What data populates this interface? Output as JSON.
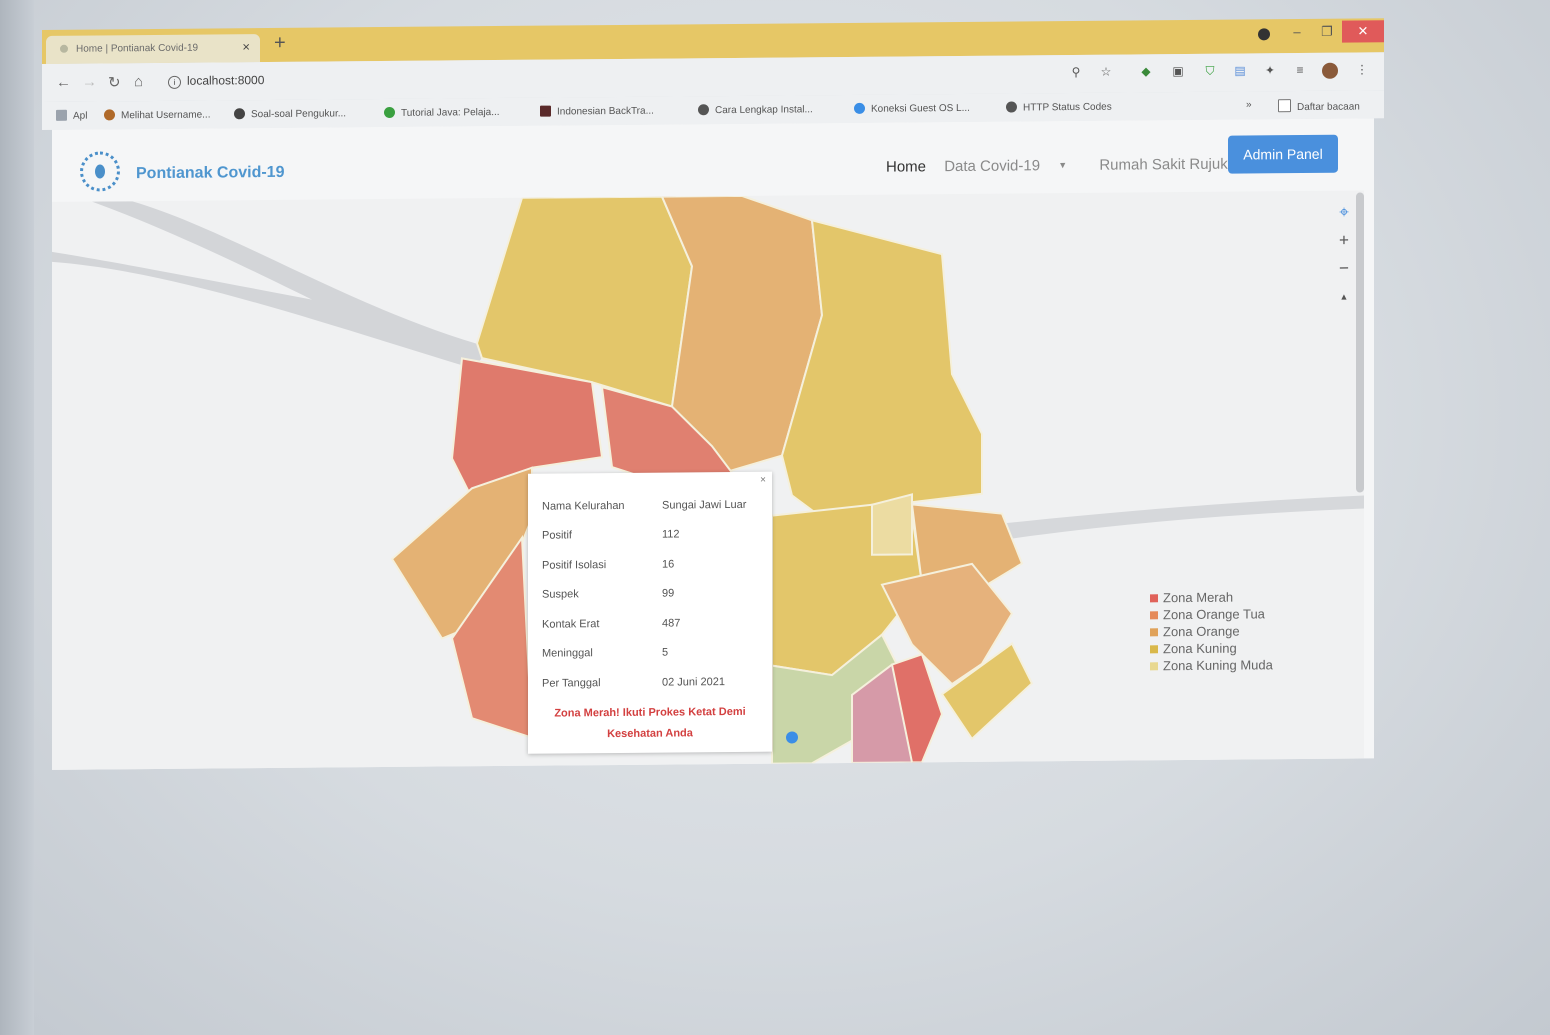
{
  "browser": {
    "tab_title": "Home | Pontianak Covid-19",
    "tab_close": "×",
    "new_tab": "+",
    "window_buttons": [
      "–",
      "❐",
      "✕"
    ],
    "address": "localhost:8000",
    "bookmarks": [
      "Apl",
      "Melihat Username...",
      "Soal-soal Pengukur...",
      "Tutorial Java: Pelaja...",
      "Indonesian BackTra...",
      "Cara Lengkap Instal...",
      "Koneksi Guest OS L...",
      "HTTP Status Codes"
    ],
    "bookmarks_overflow": "»",
    "reading_list": "Daftar bacaan"
  },
  "navbar": {
    "brand": "Pontianak Covid-19",
    "links": [
      "Home",
      "Data Covid-19",
      "Rumah Sakit Rujukan"
    ],
    "admin_button": "Admin Panel"
  },
  "map": {
    "controls": [
      "⌖",
      "+",
      "−",
      "▲"
    ],
    "popup": {
      "close": "×",
      "rows": [
        {
          "label": "Nama Kelurahan",
          "value": "Sungai Jawi Luar"
        },
        {
          "label": "Positif",
          "value": "112"
        },
        {
          "label": "Positif Isolasi",
          "value": "16"
        },
        {
          "label": "Suspek",
          "value": "99"
        },
        {
          "label": "Kontak Erat",
          "value": "487"
        },
        {
          "label": "Meninggal",
          "value": "5"
        },
        {
          "label": "Per Tanggal",
          "value": "02 Juni 2021"
        }
      ],
      "warning": "Zona Merah! Ikuti Prokes Ketat Demi Kesehatan Anda"
    },
    "legend": [
      {
        "label": "Zona Merah",
        "color": "#e0625a"
      },
      {
        "label": "Zona Orange Tua",
        "color": "#e58a5a"
      },
      {
        "label": "Zona Orange",
        "color": "#e0a25a"
      },
      {
        "label": "Zona Kuning",
        "color": "#d9b84a"
      },
      {
        "label": "Zona Kuning Muda",
        "color": "#e8d890"
      }
    ]
  }
}
